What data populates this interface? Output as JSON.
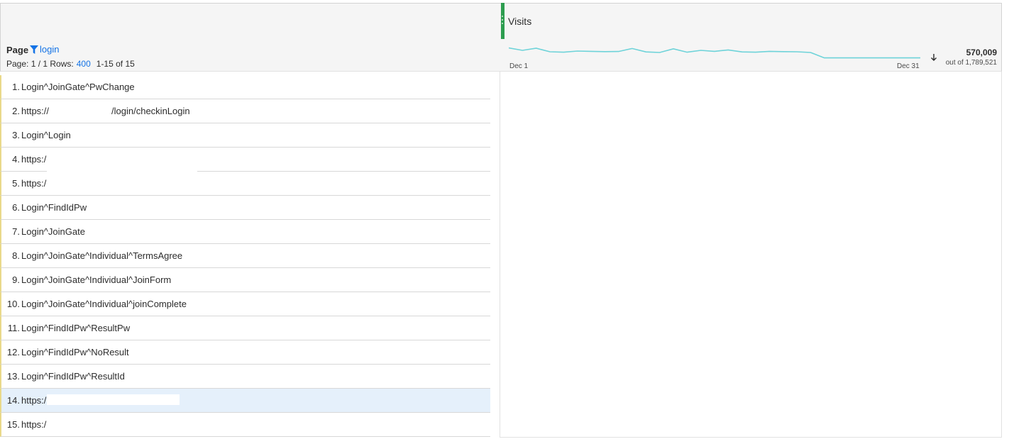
{
  "metric": {
    "title": "Visits",
    "total": "570,009",
    "total_sub": "out of 1,789,521",
    "spark_start": "Dec 1",
    "spark_end": "Dec 31",
    "sparkline": [
      0.72,
      0.55,
      0.7,
      0.45,
      0.42,
      0.5,
      0.48,
      0.46,
      0.47,
      0.68,
      0.44,
      0.4,
      0.66,
      0.42,
      0.55,
      0.48,
      0.58,
      0.44,
      0.42,
      0.48,
      0.46,
      0.45,
      0.4,
      0.02,
      0.02,
      0.02,
      0.02,
      0.02,
      0.02,
      0.02,
      0.02
    ],
    "spark_color": "#6ed3d9"
  },
  "dimension": {
    "title": "Page",
    "filter_text": "login",
    "pager_label": "Page: 1 / 1",
    "rows_label": "Rows:",
    "rows_value": "400",
    "range": "1-15 of 15"
  },
  "rows": [
    {
      "num": "1.",
      "text": "Login^JoinGate^PwChange"
    },
    {
      "num": "2.",
      "text": "https://",
      "suffix": "/login/checkinLogin"
    },
    {
      "num": "3.",
      "text": "Login^Login"
    },
    {
      "num": "4.",
      "text": "https:/"
    },
    {
      "num": "5.",
      "text": "https:/"
    },
    {
      "num": "6.",
      "text": "Login^FindIdPw"
    },
    {
      "num": "7.",
      "text": "Login^JoinGate"
    },
    {
      "num": "8.",
      "text": "Login^JoinGate^Individual^TermsAgree"
    },
    {
      "num": "9.",
      "text": "Login^JoinGate^Individual^JoinForm"
    },
    {
      "num": "10.",
      "text": "Login^JoinGate^Individual^joinComplete"
    },
    {
      "num": "11.",
      "text": "Login^FindIdPw^ResultPw"
    },
    {
      "num": "12.",
      "text": "Login^FindIdPw^NoResult"
    },
    {
      "num": "13.",
      "text": "Login^FindIdPw^ResultId"
    },
    {
      "num": "14.",
      "text": "https:/"
    },
    {
      "num": "15.",
      "text": "https:/"
    }
  ],
  "colors": {
    "accent": "#1473e6",
    "handle": "#2d9d4f",
    "selected_row": "#e5f0fb",
    "row_marker": "#e9d98a"
  },
  "icons": {
    "filter": "funnel-icon",
    "sort": "sort-descending-icon",
    "handle": "drag-handle-icon"
  }
}
